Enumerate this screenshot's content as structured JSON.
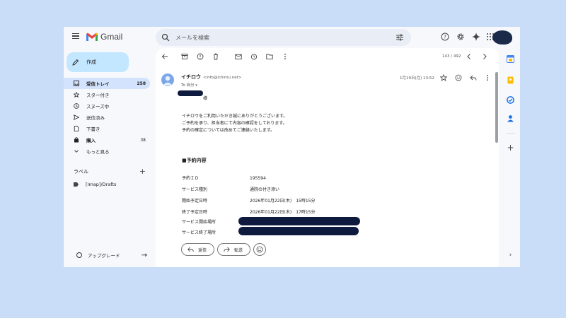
{
  "app": {
    "name": "Gmail"
  },
  "search": {
    "placeholder": "メールを検索"
  },
  "compose": {
    "label": "作成"
  },
  "nav": {
    "items": [
      {
        "label": "受信トレイ",
        "count": "258"
      },
      {
        "label": "スター付き",
        "count": ""
      },
      {
        "label": "スヌーズ中",
        "count": ""
      },
      {
        "label": "送信済み",
        "count": ""
      },
      {
        "label": "下書き",
        "count": ""
      },
      {
        "label": "購入",
        "count": "38"
      },
      {
        "label": "もっと見る",
        "count": ""
      }
    ]
  },
  "labels": {
    "heading": "ラベル",
    "items": [
      {
        "label": "[Imap]/Drafts"
      }
    ]
  },
  "upgrade": {
    "label": "アップグレード"
  },
  "toolbar": {
    "pager": "143 / 492"
  },
  "email": {
    "sender_name": "イチロウ",
    "sender_email": "<info@ichirou.net>",
    "to": "To 自分",
    "date": "1月19日(月) 13:52",
    "greeting_suffix": "様",
    "body_lines": [
      "イチロウをご利用いただき誠にありがとうございます。",
      "ご予約を承り、担当者にて内容の確認をしております。",
      "予約の確定については改めてご連絡いたします。"
    ],
    "section_title": "■予約内容",
    "details": [
      {
        "key": "予約ＩＤ",
        "value": "195594"
      },
      {
        "key": "サービス種別",
        "value": "通院の付き添い"
      },
      {
        "key": "開始予定日時",
        "value": "2026年01月22日(木)　15時15分"
      },
      {
        "key": "終了予定日時",
        "value": "2026年01月22日(木)　17時15分"
      },
      {
        "key": "サービス開始場所",
        "value": ""
      },
      {
        "key": "サービス終了場所",
        "value": ""
      }
    ]
  },
  "reply_bar": {
    "reply": "返信",
    "forward": "転送"
  },
  "colors": {
    "accent": "#c2e7ff",
    "active_nav": "#d3e3fd",
    "redaction": "#0f1b3e",
    "background": "#c9dcf8"
  }
}
